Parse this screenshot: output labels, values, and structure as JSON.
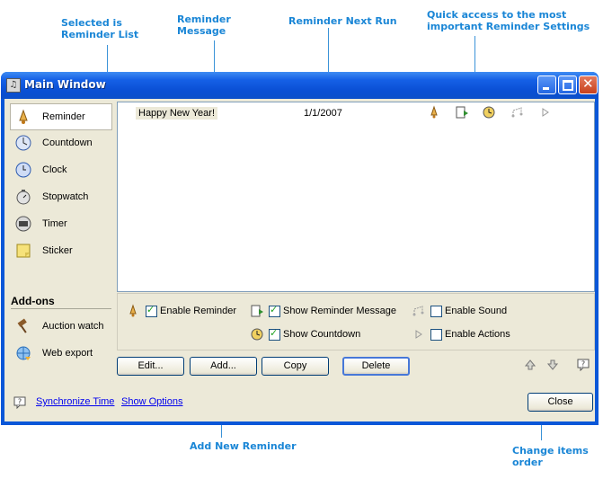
{
  "annotations": {
    "selected": "Selected is\nReminder List",
    "message": "Reminder\nMessage",
    "next_run": "Reminder Next Run",
    "quick": "Quick access to the most\nimportant Reminder Settings",
    "add_new": "Add New Reminder",
    "change_order": "Change items\norder"
  },
  "window": {
    "title": "Main Window"
  },
  "sidebar": {
    "items": [
      {
        "label": "Reminder",
        "icon": "bell-icon"
      },
      {
        "label": "Countdown",
        "icon": "countdown-icon"
      },
      {
        "label": "Clock",
        "icon": "clock-icon"
      },
      {
        "label": "Stopwatch",
        "icon": "stopwatch-icon"
      },
      {
        "label": "Timer",
        "icon": "timer-icon"
      },
      {
        "label": "Sticker",
        "icon": "sticker-icon"
      }
    ],
    "addons_title": "Add-ons",
    "addons": [
      {
        "label": "Auction watch",
        "icon": "auction-icon"
      },
      {
        "label": "Web export",
        "icon": "web-export-icon"
      }
    ]
  },
  "list": {
    "rows": [
      {
        "message": "Happy New Year!",
        "next_run": "1/1/2007"
      }
    ]
  },
  "settings": {
    "enable_reminder": "Enable Reminder",
    "show_message": "Show Reminder Message",
    "enable_sound": "Enable Sound",
    "show_countdown": "Show Countdown",
    "enable_actions": "Enable Actions"
  },
  "buttons": {
    "edit": "Edit...",
    "add": "Add...",
    "copy": "Copy",
    "delete": "Delete",
    "close": "Close"
  },
  "footer": {
    "sync": "Synchronize Time",
    "options": "Show Options"
  },
  "colors": {
    "annotation": "#1a86d6",
    "titlebar": "#0a4fd4",
    "client": "#ece9d8"
  }
}
